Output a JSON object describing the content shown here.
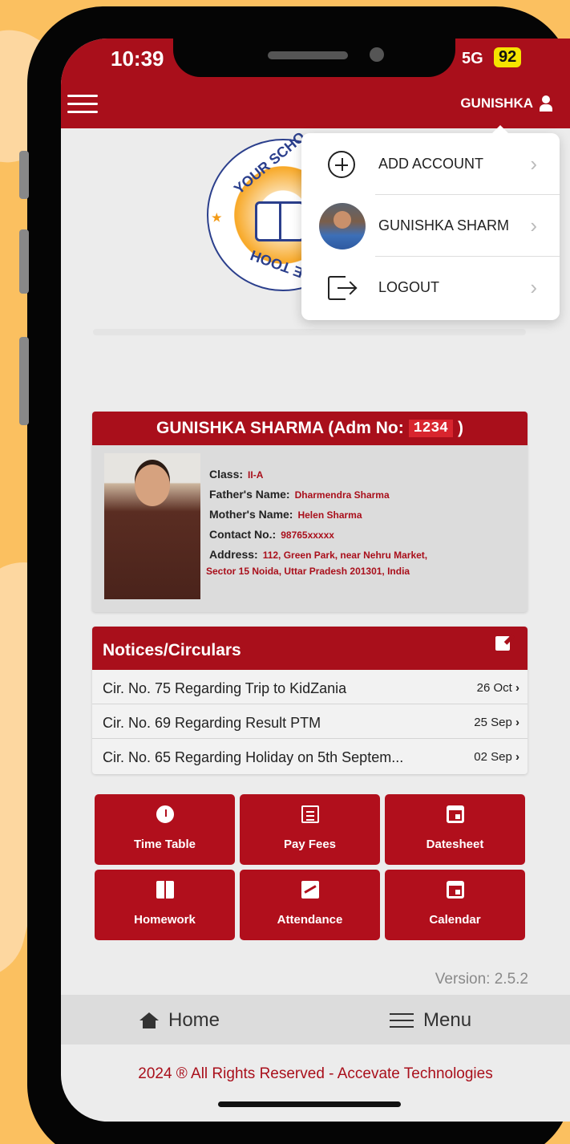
{
  "status_bar": {
    "time": "10:39",
    "network": "5G",
    "battery": "92"
  },
  "header": {
    "username": "GUNISHKA",
    "menu_icon": "hamburger-icon",
    "user_icon": "user-icon"
  },
  "account_menu": {
    "items": [
      {
        "label": "ADD ACCOUNT",
        "icon": "plus-circle-icon"
      },
      {
        "label": "GUNISHKA SHARM",
        "icon": "avatar"
      },
      {
        "label": "LOGOUT",
        "icon": "logout-icon"
      }
    ],
    "chevron": "›"
  },
  "school_logo": {
    "text_top": "YOUR SCHO",
    "text_bottom": "NAME TOOH"
  },
  "student": {
    "name_prefix": "GUNISHKA SHARMA (Adm No:",
    "adm_no": "1234",
    "name_suffix": ")",
    "class_label": "Class:",
    "class_value": "II-A",
    "father_label": "Father's Name:",
    "father_value": "Dharmendra Sharma",
    "mother_label": "Mother's Name:",
    "mother_value": "Helen Sharma",
    "contact_label": "Contact No.:",
    "contact_value": "98765xxxxx",
    "address_label": "Address:",
    "address_line1": "112, Green Park, near Nehru Market,",
    "address_line2": "Sector 15 Noida, Uttar Pradesh 201301, India"
  },
  "notices": {
    "title": "Notices/Circulars",
    "items": [
      {
        "text": "Cir. No. 75 Regarding Trip to KidZania",
        "date": "26 Oct"
      },
      {
        "text": "Cir. No. 69 Regarding Result PTM",
        "date": "25 Sep"
      },
      {
        "text": "Cir. No. 65 Regarding Holiday on 5th Septem...",
        "date": "02 Sep"
      }
    ],
    "chevron": "›"
  },
  "tiles": [
    {
      "label": "Time Table",
      "icon": "clock-icon"
    },
    {
      "label": "Pay Fees",
      "icon": "document-icon"
    },
    {
      "label": "Datesheet",
      "icon": "calendar-icon"
    },
    {
      "label": "Homework",
      "icon": "book-icon"
    },
    {
      "label": "Attendance",
      "icon": "chart-icon"
    },
    {
      "label": "Calendar",
      "icon": "calendar-icon"
    }
  ],
  "version": "Version: 2.5.2",
  "tabbar": {
    "home": "Home",
    "menu": "Menu"
  },
  "footer": "2024 ® All Rights Reserved - Accevate Technologies",
  "colors": {
    "primary": "#a90f1b",
    "background": "#fbc060"
  }
}
